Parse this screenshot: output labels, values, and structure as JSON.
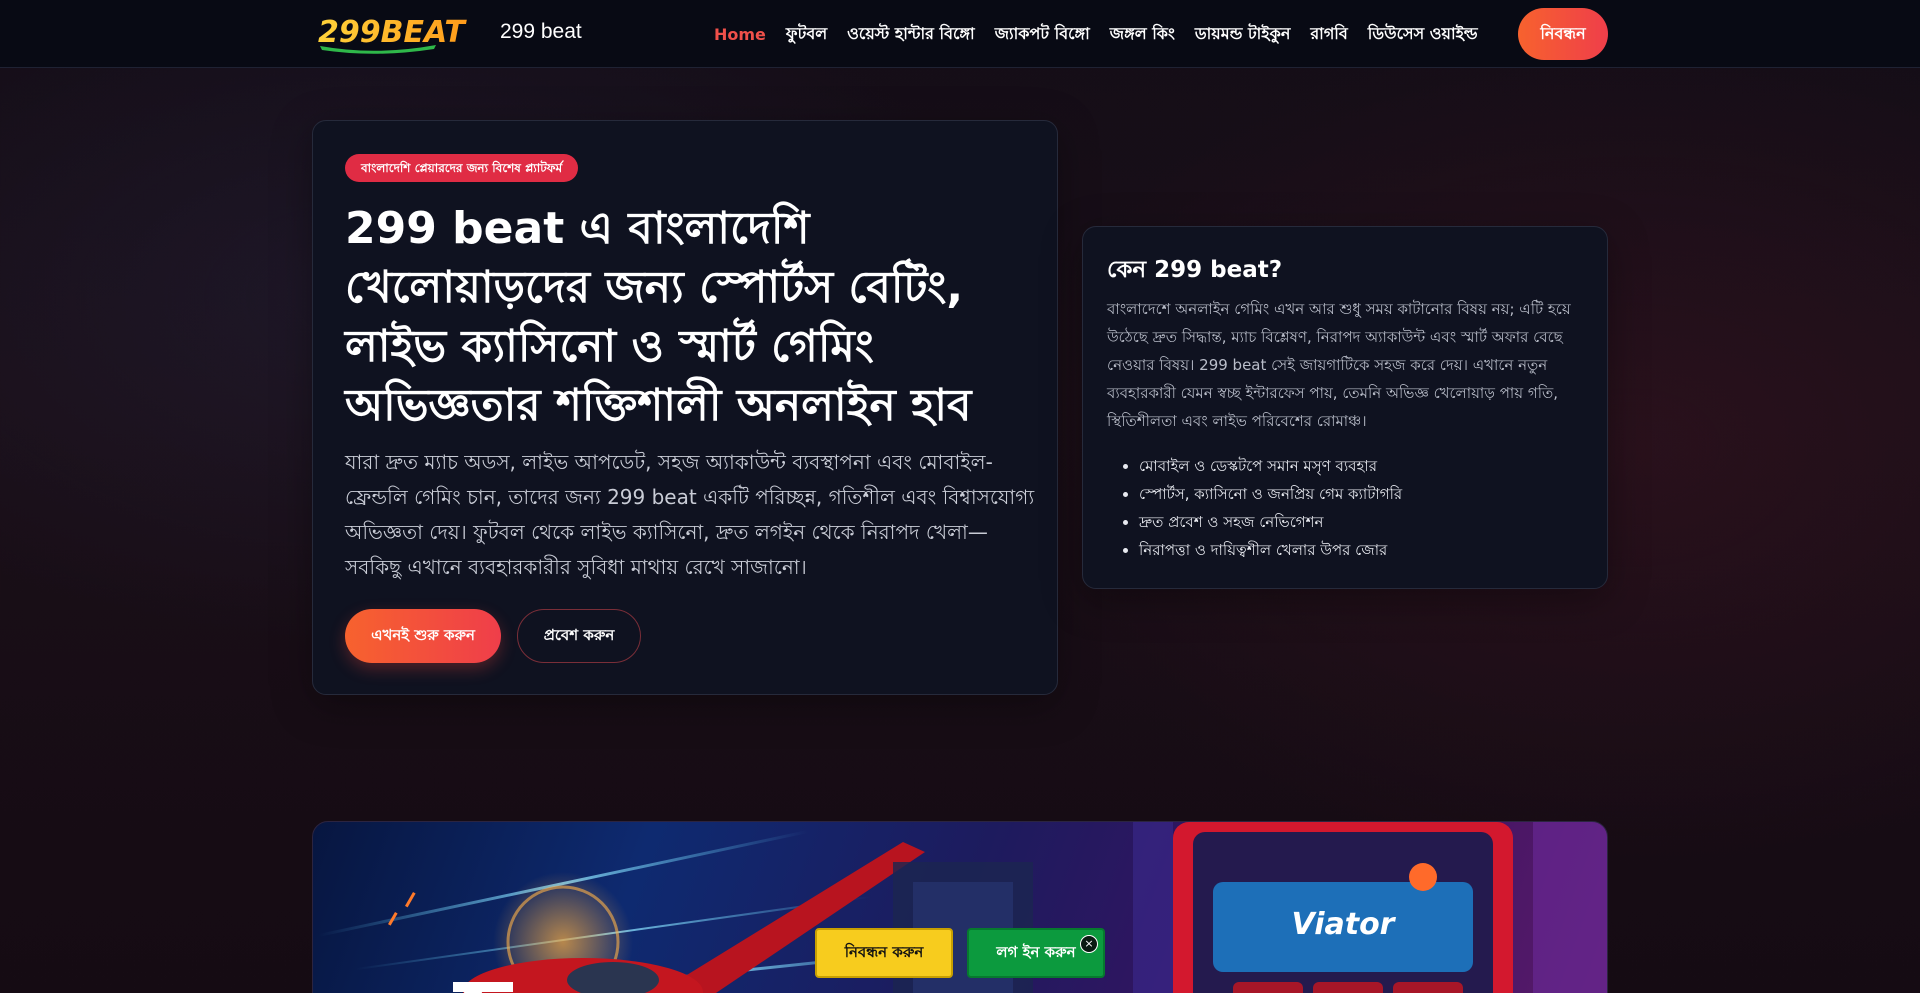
{
  "header": {
    "logo_text": "299BEAT",
    "brand_name": "299 beat",
    "nav": [
      {
        "label": "Home",
        "active": true
      },
      {
        "label": "ফুটবল"
      },
      {
        "label": "ওয়েস্ট হান্টার বিঙ্গো"
      },
      {
        "label": "জ্যাকপট বিঙ্গো"
      },
      {
        "label": "জঙ্গল কিং"
      },
      {
        "label": "ডায়মন্ড টাইকুন"
      },
      {
        "label": "রাগবি"
      },
      {
        "label": "ডিউসেস ওয়াইল্ড"
      }
    ],
    "register_label": "নিবন্ধন"
  },
  "hero": {
    "badge": "বাংলাদেশি প্লেয়ারদের জন্য বিশেষ প্ল্যাটফর্ম",
    "title": "299 beat এ বাংলাদেশি খেলোয়াড়দের জন্য স্পোর্টস বেটিং, লাইভ ক্যাসিনো ও স্মার্ট গেমিং অভিজ্ঞতার শক্তিশালী অনলাইন হাব",
    "description": "যারা দ্রুত ম্যাচ অডস, লাইভ আপডেট, সহজ অ্যাকাউন্ট ব্যবস্থাপনা এবং মোবাইল-ফ্রেন্ডলি গেমিং চান, তাদের জন্য 299 beat একটি পরিচ্ছন্ন, গতিশীল এবং বিশ্বাসযোগ্য অভিজ্ঞতা দেয়। ফুটবল থেকে লাইভ ক্যাসিনো, দ্রুত লগইন থেকে নিরাপদ খেলা—সবকিছু এখানে ব্যবহারকারীর সুবিধা মাথায় রেখে সাজানো।",
    "primary_button": "এখনই শুরু করুন",
    "secondary_button": "প্রবেশ করুন"
  },
  "why": {
    "title": "কেন 299 beat?",
    "text": "বাংলাদেশে অনলাইন গেমিং এখন আর শুধু সময় কাটানোর বিষয় নয়; এটি হয়ে উঠেছে দ্রুত সিদ্ধান্ত, ম্যাচ বিশ্লেষণ, নিরাপদ অ্যাকাউন্ট এবং স্মার্ট অফার বেছে নেওয়ার বিষয়। 299 beat সেই জায়গাটিকে সহজ করে দেয়। এখানে নতুন ব্যবহারকারী যেমন স্বচ্ছ ইন্টারফেস পায়, তেমনি অভিজ্ঞ খেলোয়াড় পায় গতি, স্থিতিশীলতা এবং লাইভ পরিবেশের রোমাঞ্চ।",
    "items": [
      "মোবাইল ও ডেস্কটপে সমান মসৃণ ব্যবহার",
      "স্পোর্টস, ক্যাসিনো ও জনপ্রিয় গেম ক্যাটাগরি",
      "দ্রুত প্রবেশ ও সহজ নেভিগেশন",
      "নিরাপত্তা ও দায়িত্বশীল খেলার উপর জোর"
    ]
  },
  "banner": {
    "machine_text": "Viator"
  },
  "sticky": {
    "register": "নিবন্ধন করুন",
    "login": "লগ ইন করুন",
    "close": "×"
  },
  "colors": {
    "accent": "#f0504a",
    "badge": "#e02c44",
    "register_yellow": "#f7cc1e",
    "login_green": "#0c9a3e",
    "card_bg": "#0f1220"
  }
}
